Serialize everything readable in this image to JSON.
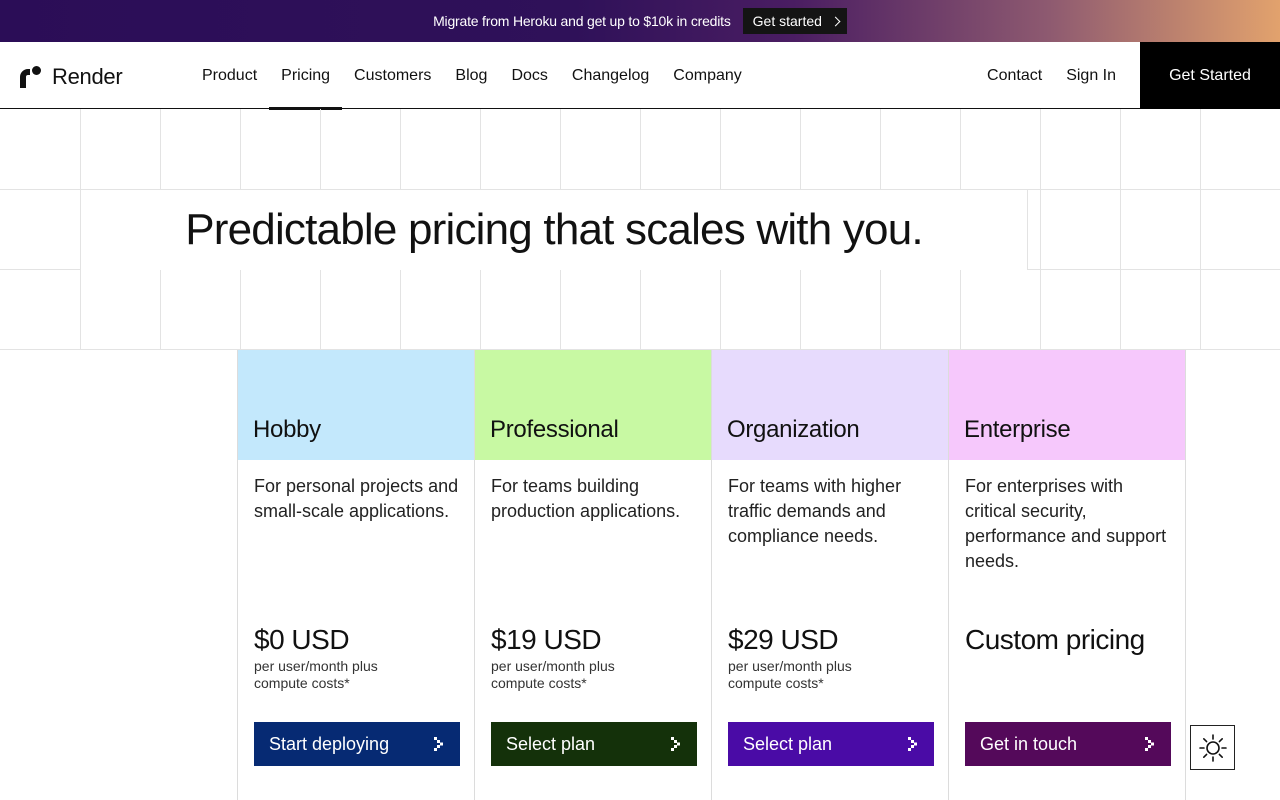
{
  "banner": {
    "text": "Migrate from Heroku and get up to $10k in credits",
    "button_label": "Get started"
  },
  "nav": {
    "logo_text": "Render",
    "links": [
      {
        "label": "Product"
      },
      {
        "label": "Pricing",
        "active": true
      },
      {
        "label": "Customers"
      },
      {
        "label": "Blog"
      },
      {
        "label": "Docs"
      },
      {
        "label": "Changelog"
      },
      {
        "label": "Company"
      }
    ],
    "contact": "Contact",
    "sign_in": "Sign In",
    "cta": "Get Started"
  },
  "hero": {
    "title": "Predictable pricing that scales with you."
  },
  "plans": [
    {
      "name": "Hobby",
      "description": "For personal projects and small-scale applications.",
      "price": "$0 USD",
      "note": "per user/month plus compute costs*",
      "button": "Start deploying",
      "head_color": "#c3e8fc",
      "button_color": "#062a73"
    },
    {
      "name": "Professional",
      "description": "For teams building production applications.",
      "price": "$19 USD",
      "note": "per user/month plus compute costs*",
      "button": "Select plan",
      "head_color": "#c8f9a3",
      "button_color": "#14310a"
    },
    {
      "name": "Organization",
      "description": "For teams with higher traffic demands and compliance needs.",
      "price": "$29 USD",
      "note": "per user/month plus compute costs*",
      "button": "Select plan",
      "head_color": "#e7dbfd",
      "button_color": "#4a0ba6"
    },
    {
      "name": "Enterprise",
      "description": "For enterprises with critical security, performance and support needs.",
      "price": "Custom pricing",
      "note": "",
      "button": "Get in touch",
      "head_color": "#f6c8fc",
      "button_color": "#54095a"
    }
  ],
  "icons": {
    "logo": "render-logo-icon",
    "theme": "sun-icon",
    "arrow": "pixel-arrow-icon"
  }
}
